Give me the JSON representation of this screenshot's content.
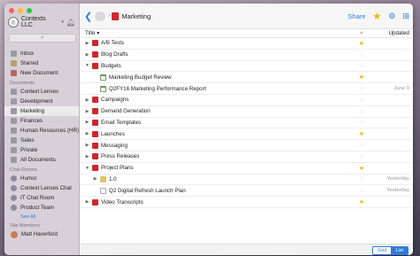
{
  "sidebar": {
    "workspace": "Contexts LLC",
    "search_icon": "⌕",
    "items_top": [
      {
        "label": "Inbox",
        "icon": "inbox-icon"
      },
      {
        "label": "Starred",
        "icon": "star-icon"
      },
      {
        "label": "New Document",
        "icon": "new-document-icon"
      }
    ],
    "documents_heading": "Documents",
    "documents": [
      {
        "label": "Context Lenses"
      },
      {
        "label": "Development"
      },
      {
        "label": "Marketing",
        "selected": true
      },
      {
        "label": "Finances"
      },
      {
        "label": "Human Resources (HR)"
      },
      {
        "label": "Sales"
      },
      {
        "label": "Private"
      },
      {
        "label": "All Documents"
      }
    ],
    "chat_heading": "Chat Rooms",
    "chats": [
      {
        "label": "Humor"
      },
      {
        "label": "Context Lenses Chat"
      },
      {
        "label": "IT Chat Room"
      },
      {
        "label": "Product Team"
      }
    ],
    "see_all": "See All",
    "members_heading": "Site Members",
    "members": [
      {
        "label": "Matt Haverford"
      }
    ]
  },
  "toolbar": {
    "breadcrumb_title": "Marketing",
    "share_label": "Share"
  },
  "table": {
    "col_title": "Title",
    "col_star": "★",
    "col_updated": "Updated",
    "rows": [
      {
        "title": "A/B Tests",
        "indent": 0,
        "expander": "▶",
        "icon": "folder",
        "starred": true,
        "updated": ""
      },
      {
        "title": "Blog Drafts",
        "indent": 0,
        "expander": "▶",
        "icon": "folder",
        "starred": false,
        "updated": ""
      },
      {
        "title": "Budgets",
        "indent": 0,
        "expander": "▼",
        "icon": "folder",
        "starred": false,
        "updated": ""
      },
      {
        "title": "Marketing Budget Review",
        "indent": 1,
        "expander": "",
        "icon": "doc",
        "starred": true,
        "updated": ""
      },
      {
        "title": "Q2FY16 Marketing Performance Report",
        "indent": 1,
        "expander": "",
        "icon": "doc",
        "starred": false,
        "updated": "June 9"
      },
      {
        "title": "Campaigns",
        "indent": 0,
        "expander": "▶",
        "icon": "folder",
        "starred": false,
        "updated": ""
      },
      {
        "title": "Demand Generation",
        "indent": 0,
        "expander": "▶",
        "icon": "folder",
        "starred": false,
        "updated": ""
      },
      {
        "title": "Email Templates",
        "indent": 0,
        "expander": "▶",
        "icon": "folder",
        "starred": false,
        "updated": ""
      },
      {
        "title": "Launches",
        "indent": 0,
        "expander": "▶",
        "icon": "folder",
        "starred": true,
        "updated": ""
      },
      {
        "title": "Messaging",
        "indent": 0,
        "expander": "▶",
        "icon": "folder",
        "starred": false,
        "updated": ""
      },
      {
        "title": "Press Releases",
        "indent": 0,
        "expander": "▶",
        "icon": "folder",
        "starred": false,
        "updated": ""
      },
      {
        "title": "Project Plans",
        "indent": 0,
        "expander": "▼",
        "icon": "folder",
        "starred": true,
        "updated": ""
      },
      {
        "title": "1.0",
        "indent": 1,
        "expander": "▶",
        "icon": "sub",
        "starred": false,
        "updated": "Yesterday"
      },
      {
        "title": "Q2 Digital Refresh Launch Plan",
        "indent": 1,
        "expander": "",
        "icon": "blank",
        "starred": false,
        "updated": "Yesterday"
      },
      {
        "title": "Video Transcripts",
        "indent": 0,
        "expander": "▶",
        "icon": "folder",
        "starred": true,
        "updated": ""
      }
    ]
  },
  "footer": {
    "grid_label": "Grid",
    "list_label": "List"
  },
  "colors": {
    "accent": "#2f7adb",
    "star": "#f5b400",
    "folder": "#d0252b"
  }
}
